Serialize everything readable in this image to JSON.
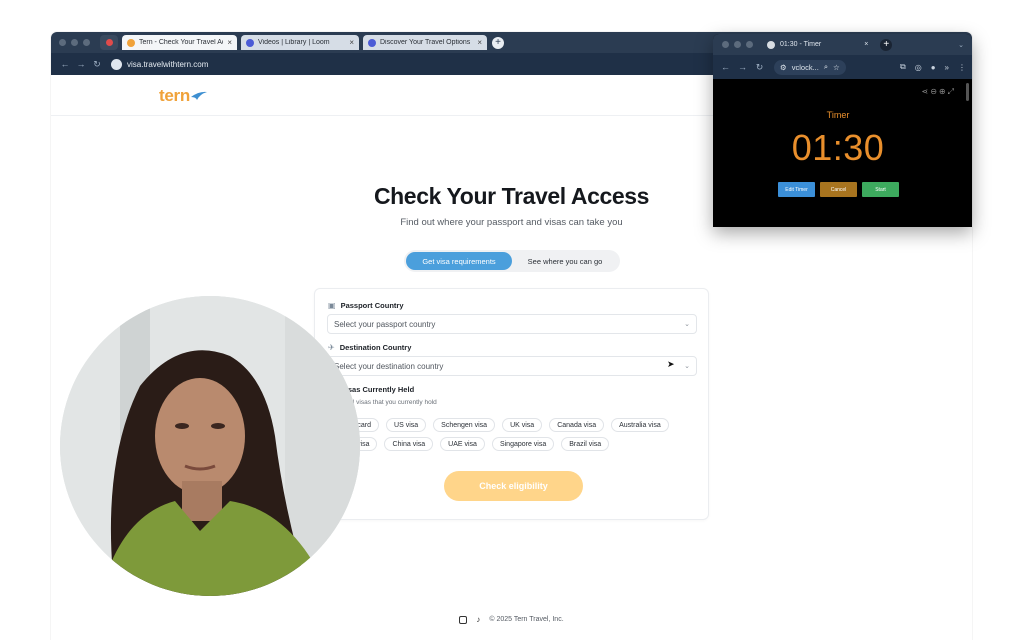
{
  "browser": {
    "tabs": [
      {
        "label": "Tern - Check Your Travel Ac...",
        "color": "#f0a23a"
      },
      {
        "label": "Videos | Library | Loom",
        "color": "#4b5bd6"
      },
      {
        "label": "Discover Your Travel Options",
        "color": "#4b5bd6"
      }
    ],
    "url": "visa.travelwithtern.com"
  },
  "page": {
    "logo_text": "tern",
    "title": "Check Your Travel Access",
    "subtitle": "Find out where your passport and visas can take you",
    "toggle": {
      "active": "Get visa requirements",
      "inactive": "See where you can go"
    },
    "passport": {
      "label": "Passport Country",
      "placeholder": "Select your passport country"
    },
    "destination": {
      "label": "Destination Country",
      "placeholder": "Select your destination country"
    },
    "visas": {
      "label": "Visas Currently Held",
      "hint": "Select all visas that you currently hold",
      "chips": [
        "Green card",
        "US visa",
        "Schengen visa",
        "UK visa",
        "Canada visa",
        "Australia visa",
        "Japan visa",
        "China visa",
        "UAE visa",
        "Singapore visa",
        "Brazil visa"
      ]
    },
    "cta": "Check eligibility",
    "footer": "© 2025 Tern Travel, Inc."
  },
  "timer_window": {
    "tab_title": "01:30 - Timer",
    "url": "vclock...",
    "label": "Timer",
    "time": "01:30",
    "buttons": [
      {
        "label": "Edit Timer",
        "color": "#3b8fd8"
      },
      {
        "label": "Cancel",
        "color": "#a8741f"
      },
      {
        "label": "Start",
        "color": "#3daa5e"
      }
    ]
  }
}
